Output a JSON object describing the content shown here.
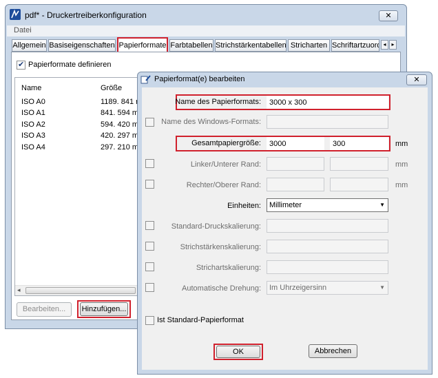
{
  "main_window": {
    "title": "pdf* - Druckertreiberkonfiguration",
    "close_glyph": "✕",
    "menu": [
      "Datei"
    ],
    "tabs": [
      "Allgemein",
      "Basiseigenschaften",
      "Papierformate",
      "Farbtabellen",
      "Strichstärkentabellen",
      "Stricharten",
      "Schriftartzuord"
    ],
    "active_tab": "Papierformate",
    "tab_scroll": [
      "◂",
      "▸"
    ],
    "define_checkbox": {
      "label": "Papierformate definieren",
      "checked": true
    },
    "list": {
      "columns": [
        "Name",
        "Größe"
      ],
      "rows": [
        [
          "ISO A0",
          "1189. 841 r"
        ],
        [
          "ISO A1",
          "841. 594 mr"
        ],
        [
          "ISO A2",
          "594. 420 mr"
        ],
        [
          "ISO A3",
          "420. 297 mr"
        ],
        [
          "ISO A4",
          "297. 210 mr"
        ]
      ],
      "scroll_left": "◂"
    },
    "buttons": {
      "edit": "Bearbeiten...",
      "add": "Hinzufügen..."
    }
  },
  "dialog": {
    "title": "Papierformat(e) bearbeiten",
    "close_glyph": "✕",
    "fields": {
      "name": {
        "label": "Name des Papierformats:",
        "value": "3000 x 300"
      },
      "windows_format": {
        "label": "Name des Windows-Formats:",
        "value": ""
      },
      "total_size": {
        "label": "Gesamtpapiergröße:",
        "value1": "3000",
        "value2": "300",
        "unit": "mm"
      },
      "left_bottom_margin": {
        "label": "Linker/Unterer Rand:",
        "value1": "",
        "value2": "",
        "unit": "mm"
      },
      "right_top_margin": {
        "label": "Rechter/Oberer Rand:",
        "value1": "",
        "value2": "",
        "unit": "mm"
      },
      "units": {
        "label": "Einheiten:",
        "value": "Millimeter"
      },
      "print_scale": {
        "label": "Standard-Druckskalierung:",
        "value": ""
      },
      "line_weight_scale": {
        "label": "Strichstärkenskalierung:",
        "value": ""
      },
      "line_style_scale": {
        "label": "Strichartskalierung:",
        "value": ""
      },
      "auto_rotate": {
        "label": "Automatische Drehung:",
        "value": "Im Uhrzeigersinn"
      }
    },
    "default_checkbox": {
      "label": "Ist Standard-Papierformat",
      "checked": false
    },
    "buttons": {
      "ok": "OK",
      "cancel": "Abbrechen"
    }
  },
  "colors": {
    "highlight": "#d0202c",
    "window_frame": "#c9d7e8"
  }
}
